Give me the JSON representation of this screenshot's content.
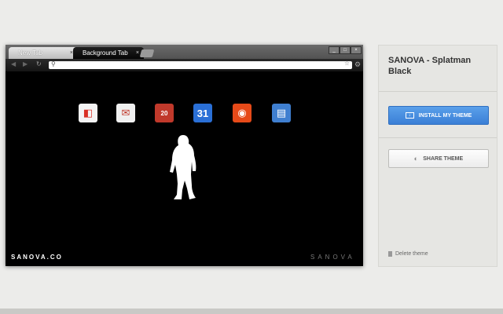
{
  "browser": {
    "tabs": [
      {
        "label": "New Tab",
        "active": true
      },
      {
        "label": "Background Tab",
        "active": false
      }
    ],
    "tab_close_glyph": "×",
    "window_controls": [
      "_",
      "□",
      "×"
    ],
    "omnibox_value": "",
    "apps": [
      {
        "icon": "chrome-web-store-icon",
        "glyph": "◧",
        "color": "#f4f4f4"
      },
      {
        "icon": "gmail-icon",
        "glyph": "✉",
        "color": "#f0f0f0"
      },
      {
        "icon": "calendar-date-icon",
        "glyph": "20",
        "color": "#c0392b"
      },
      {
        "icon": "google-calendar-icon",
        "glyph": "31",
        "color": "#2a6fd6"
      },
      {
        "icon": "rss-reader-icon",
        "glyph": "◉",
        "color": "#e64a19"
      },
      {
        "icon": "google-books-icon",
        "glyph": "▤",
        "color": "#3f7fd0"
      }
    ],
    "brand_left": "SANOVA.CO",
    "brand_right": "SANOVA"
  },
  "panel": {
    "theme_title": "SANOVA - Splatman Black",
    "install_label": "INSTALL MY THEME",
    "share_label": "SHARE THEME",
    "delete_label": "Delete theme"
  },
  "colors": {
    "accent": "#4a90e2",
    "page_bg": "#ececea",
    "browser_bg": "#000000"
  }
}
